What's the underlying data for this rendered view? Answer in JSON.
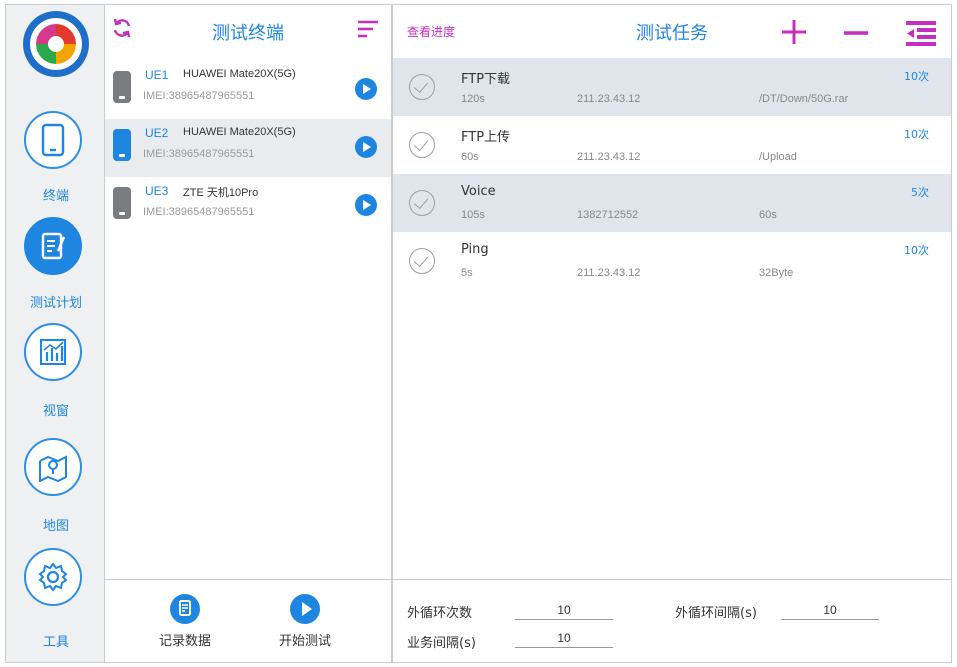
{
  "nav": {
    "items": [
      {
        "label": "终端",
        "icon": "phone-icon"
      },
      {
        "label": "测试计划",
        "icon": "test-plan-icon"
      },
      {
        "label": "视窗",
        "icon": "chart-icon"
      },
      {
        "label": "地图",
        "icon": "map-icon"
      },
      {
        "label": "工具",
        "icon": "gear-icon"
      }
    ],
    "active_index": 1
  },
  "terminals": {
    "title": "测试终端",
    "list": [
      {
        "id": "UE1",
        "model": "HUAWEI Mate20X(5G)",
        "imei": "IMEI:38965487965551",
        "selected": false
      },
      {
        "id": "UE2",
        "model": "HUAWEI Mate20X(5G)",
        "imei": "IMEI:38965487965551",
        "selected": true
      },
      {
        "id": "UE3",
        "model": "ZTE 天机10Pro",
        "imei": "IMEI:38965487965551",
        "selected": false
      }
    ],
    "footer": {
      "record_label": "记录数据",
      "start_label": "开始测试"
    }
  },
  "tasks": {
    "progress_link": "查看进度",
    "title": "测试任务",
    "list": [
      {
        "name": "FTP下载",
        "duration": "120s",
        "address": "211.23.43.12",
        "extra": "/DT/Down/50G.rar",
        "count": "10次"
      },
      {
        "name": "FTP上传",
        "duration": "60s",
        "address": "211.23.43.12",
        "extra": "/Upload",
        "count": "10次"
      },
      {
        "name": "Voice",
        "duration": "105s",
        "address": "1382712552",
        "extra": "60s",
        "count": "5次"
      },
      {
        "name": "Ping",
        "duration": "5s",
        "address": "211.23.43.12",
        "extra": "32Byte",
        "count": "10次"
      }
    ],
    "footer": {
      "outer_loops_label": "外循环次数",
      "outer_loops_value": "10",
      "outer_interval_label": "外循环间隔(s)",
      "outer_interval_value": "10",
      "service_interval_label": "业务间隔(s)",
      "service_interval_value": "10"
    }
  },
  "colors": {
    "accent": "#1e86e0",
    "magenta": "#c42fc0",
    "selected_row": "#e9ecef",
    "shaded_row": "#dfe5ea"
  }
}
